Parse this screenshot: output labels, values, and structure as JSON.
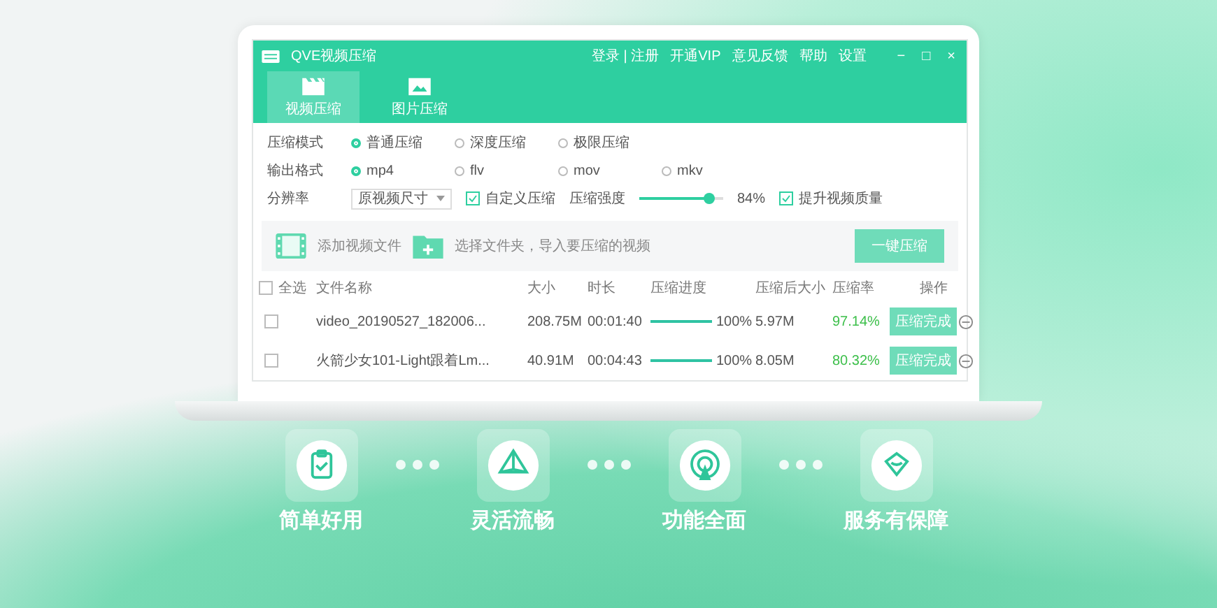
{
  "app": {
    "title": "QVE视频压缩",
    "header_links": [
      "登录 | 注册",
      "开通VIP",
      "意见反馈",
      "帮助",
      "设置"
    ],
    "window_controls": [
      "−",
      "□",
      "×"
    ],
    "tabs": [
      {
        "kind": "video",
        "label": "视频压缩",
        "selected": true
      },
      {
        "kind": "image",
        "label": "图片压缩",
        "selected": false
      }
    ],
    "compress_mode": {
      "label": "压缩模式",
      "options": [
        {
          "label": "普通压缩",
          "selected": true
        },
        {
          "label": "深度压缩",
          "selected": false
        },
        {
          "label": "极限压缩",
          "selected": false
        }
      ]
    },
    "output_format": {
      "label": "输出格式",
      "options": [
        {
          "label": "mp4",
          "selected": true
        },
        {
          "label": "flv",
          "selected": false
        },
        {
          "label": "mov",
          "selected": false
        },
        {
          "label": "mkv",
          "selected": false
        }
      ]
    },
    "resolution": {
      "label": "分辨率",
      "dropdown": "原视频尺寸",
      "custom": {
        "label": "自定义压缩",
        "checked": true
      },
      "strength": {
        "label": "压缩强度",
        "level": 0.84,
        "reading": "84%"
      },
      "quality": {
        "label": "提升视频质量",
        "checked": true
      }
    },
    "add_bar": {
      "add_file": "添加视频文件",
      "add_folder": "选择文件夹，导入要压缩的视频",
      "button": "一键压缩"
    },
    "table": {
      "select_all": {
        "label": "全选",
        "checked": false
      },
      "columns": [
        "文件名称",
        "大小",
        "时长",
        "压缩进度",
        "压缩后大小",
        "压缩率",
        "操作"
      ],
      "rows": [
        {
          "checked": false,
          "name": "video_20190527_182006...",
          "size": "208.75M",
          "duration": "00:01:40",
          "level": 1,
          "progress": "100%",
          "compressed_size": "5.97M",
          "ratio": "97.14%",
          "action": "压缩完成"
        },
        {
          "checked": false,
          "name": "火箭少女101-Light跟着Lm...",
          "size": "40.91M",
          "duration": "00:04:43",
          "level": 1,
          "progress": "100%",
          "compressed_size": "8.05M",
          "ratio": "80.32%",
          "action": "压缩完成"
        }
      ]
    }
  },
  "features": [
    {
      "kind": "clipboard",
      "label": "简单好用"
    },
    {
      "kind": "prism",
      "label": "灵活流畅"
    },
    {
      "kind": "target",
      "label": "功能全面"
    },
    {
      "kind": "diamond",
      "label": "服务有保障"
    }
  ]
}
